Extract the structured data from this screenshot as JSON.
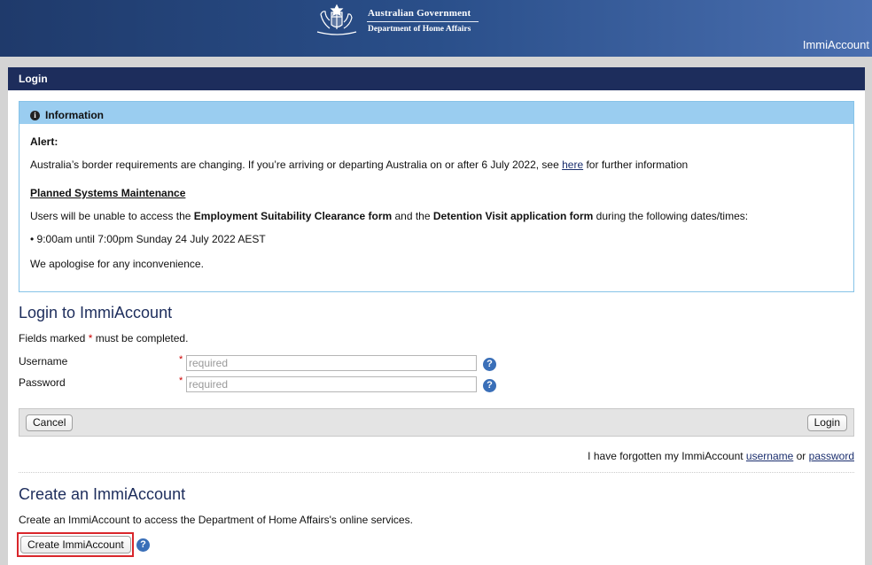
{
  "banner": {
    "gov_line1": "Australian Government",
    "gov_line2": "Department of Home Affairs",
    "app_name": "ImmiAccount"
  },
  "main": {
    "header": "Login"
  },
  "info": {
    "title": "Information",
    "alert_label": "Alert:",
    "border_text_pre": "Australia’s border requirements are changing. If you’re arriving or departing Australia on or after 6 July 2022, see ",
    "border_link": "here",
    "border_text_post": " for further information",
    "maintenance_title": "Planned Systems Maintenance",
    "maint_pre": "Users will be unable to access the ",
    "maint_form1": "Employment Suitability Clearance form",
    "maint_mid": " and the ",
    "maint_form2": "Detention Visit application form",
    "maint_post": " during the following dates/times:",
    "maint_time": "• 9:00am until 7:00pm Sunday 24 July 2022 AEST",
    "apology": "We apologise for any inconvenience."
  },
  "login": {
    "title": "Login to ImmiAccount",
    "fields_note_pre": "Fields marked ",
    "fields_note_star": "*",
    "fields_note_post": " must be completed.",
    "username_label": "Username",
    "password_label": "Password",
    "required_star": "*",
    "username_placeholder": "required",
    "password_placeholder": "required",
    "help_glyph": "?",
    "cancel_label": "Cancel",
    "login_label": "Login",
    "forgot_pre": "I have forgotten my ImmiAccount ",
    "forgot_username": "username",
    "forgot_or": " or ",
    "forgot_password": "password"
  },
  "create": {
    "title": "Create an ImmiAccount",
    "description": "Create an ImmiAccount to access the Department of Home Affairs's online services.",
    "button_label": "Create ImmiAccount"
  },
  "colors": {
    "banner": "#2a4f8a",
    "header": "#1d2d5c",
    "info_head": "#9acdf0",
    "highlight": "#d9262b"
  }
}
